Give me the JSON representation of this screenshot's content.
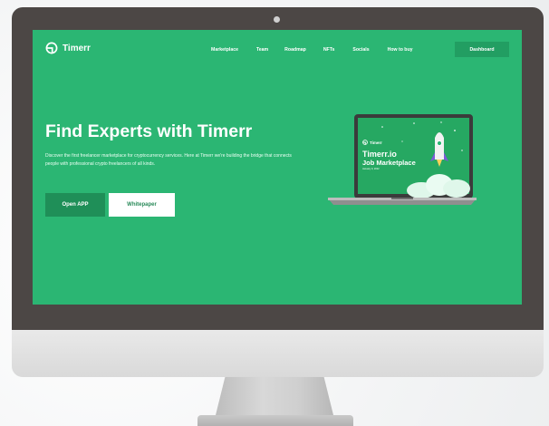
{
  "brand": {
    "name": "Timerr"
  },
  "nav": {
    "items": [
      "Marketplace",
      "Team",
      "Roadmap",
      "NFTs",
      "Socials",
      "How to buy"
    ],
    "dashboard_label": "Dashboard"
  },
  "hero": {
    "title": "Find Experts with Timerr",
    "description": "Discover the first freelancer marketplace for cryptocurrency services. Here at Timerr we're building the bridge that connects people with professional crypto freelancers of all kinds.",
    "primary_button": "Open APP",
    "secondary_button": "Whitepaper"
  },
  "laptop_screen": {
    "brand": "Timerr",
    "title_line1": "Timerr.io",
    "title_line2": "Job Marketplace",
    "date": "January 9, 2022"
  },
  "colors": {
    "screen_bg": "#2bb673",
    "bezel": "#4c4745",
    "primary_button": "#1f8f58",
    "dashboard_button": "#229e62"
  }
}
